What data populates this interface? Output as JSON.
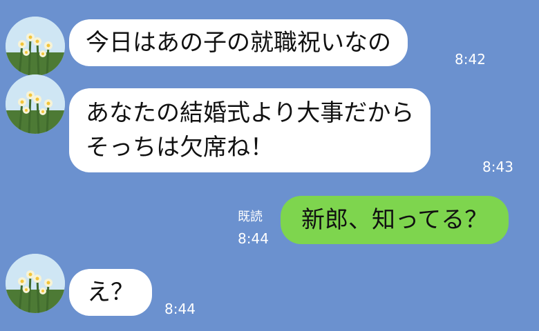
{
  "colors": {
    "background": "#6b91cf",
    "incoming_bubble": "#ffffff",
    "outgoing_bubble": "#7ed54e",
    "meta_text": "#ffffff"
  },
  "messages": [
    {
      "direction": "incoming",
      "avatar_icon": "daffodil-photo-icon",
      "lines": [
        "今日はあの子の就職祝いなの"
      ],
      "time": "8:42"
    },
    {
      "direction": "incoming",
      "avatar_icon": "daffodil-photo-icon",
      "lines": [
        "あなたの結婚式より大事だから",
        "そっちは欠席ね！"
      ],
      "time": "8:43"
    },
    {
      "direction": "outgoing",
      "lines": [
        "新郎、知ってる？"
      ],
      "read_label": "既読",
      "time": "8:44"
    },
    {
      "direction": "incoming",
      "avatar_icon": "daffodil-photo-icon",
      "lines": [
        "え？"
      ],
      "time": "8:44"
    }
  ]
}
